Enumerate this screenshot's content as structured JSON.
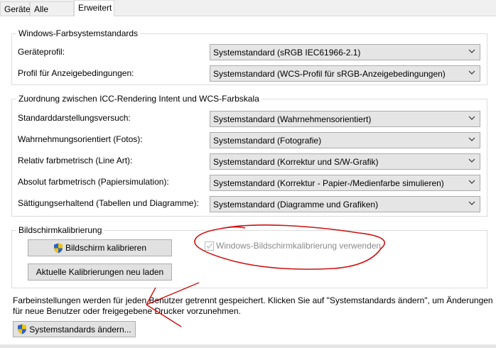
{
  "tabs": [
    {
      "label": "Geräte"
    },
    {
      "label": "Alle Profile"
    },
    {
      "label": "Erweitert"
    }
  ],
  "group1": {
    "title": "Windows-Farbsystemstandards",
    "rows": [
      {
        "label": "Geräteprofil:",
        "value": "Systemstandard (sRGB IEC61966-2.1)"
      },
      {
        "label": "Profil für Anzeigebedingungen:",
        "value": "Systemstandard (WCS-Profil für sRGB-Anzeigebedingungen)"
      }
    ]
  },
  "group2": {
    "title": "Zuordnung zwischen ICC-Rendering Intent und WCS-Farbskala",
    "rows": [
      {
        "label": "Standarddarstellungsversuch:",
        "value": "Systemstandard (Wahrnehmensorientiert)"
      },
      {
        "label": "Wahrnehmungsorientiert (Fotos):",
        "value": "Systemstandard (Fotografie)"
      },
      {
        "label": "Relativ farbmetrisch (Line Art):",
        "value": "Systemstandard (Korrektur und S/W-Grafik)"
      },
      {
        "label": "Absolut farbmetrisch (Papiersimulation):",
        "value": "Systemstandard (Korrektur - Papier-/Medienfarbe simulieren)"
      },
      {
        "label": "Sättigungserhaltend (Tabellen und Diagramme):",
        "value": "Systemstandard (Diagramme und Grafiken)"
      }
    ]
  },
  "group3": {
    "title": "Bildschirmkalibrierung",
    "calibrate": "Bildschirm kalibrieren",
    "reload": "Aktuelle Kalibrierungen neu laden",
    "checkbox": "Windows-Bildschirmkalibrierung verwenden",
    "checked": true
  },
  "note": {
    "line1": "Farbeinstellungen werden für jeden Benutzer getrennt gespeichert. Klicken Sie auf \"Systemstandards ändern\", um Änderungen",
    "line2": "für neue Benutzer oder freigegebene Drucker vorzunehmen."
  },
  "change_button": "Systemstandards ändern...",
  "colors": {
    "annotation": "#d01010"
  }
}
